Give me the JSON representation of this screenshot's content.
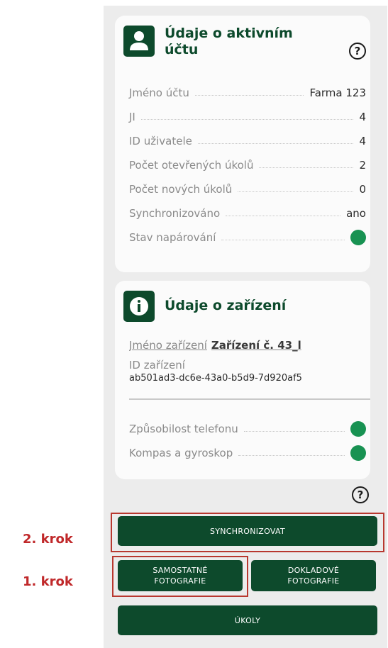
{
  "account_card": {
    "title_line1": "Údaje o aktivním",
    "title_line2": "účtu",
    "help_icon": "?",
    "rows": [
      {
        "label": "Jméno účtu",
        "value": "Farma 123"
      },
      {
        "label": "JI",
        "value": "4"
      },
      {
        "label": "ID uživatele",
        "value": "4"
      },
      {
        "label": "Počet otevřených úkolů",
        "value": "2"
      },
      {
        "label": "Počet nových úkolů",
        "value": "0"
      },
      {
        "label": "Synchronizováno",
        "value": "ano"
      },
      {
        "label": "Stav napárování",
        "value": ""
      }
    ]
  },
  "device_card": {
    "title": "Údaje o zařízení",
    "info_icon": "i",
    "name_label": "Jméno zařízení",
    "name_value": "Zařízení č. 43_l",
    "id_label": "ID zařízení",
    "id_value": "ab501ad3-dc6e-43a0-b5d9-7d920af5",
    "rows": [
      {
        "label": "Způsobilost telefonu"
      },
      {
        "label": "Kompas a gyroskop"
      }
    ]
  },
  "help_icon_bottom": "?",
  "buttons": {
    "sync": "SYNCHRONIZOVAT",
    "standalone_line1": "SAMOSTATNÉ",
    "standalone_line2": "FOTOGRAFIE",
    "evidence_line1": "DOKLADOVÉ",
    "evidence_line2": "FOTOGRAFIE",
    "tasks": "ÚKOLY"
  },
  "steps": {
    "step2": "2. krok",
    "step1": "1. krok"
  },
  "colors": {
    "brand_green": "#0d4a2c",
    "status_green": "#189252",
    "highlight_red": "#b8382f"
  }
}
